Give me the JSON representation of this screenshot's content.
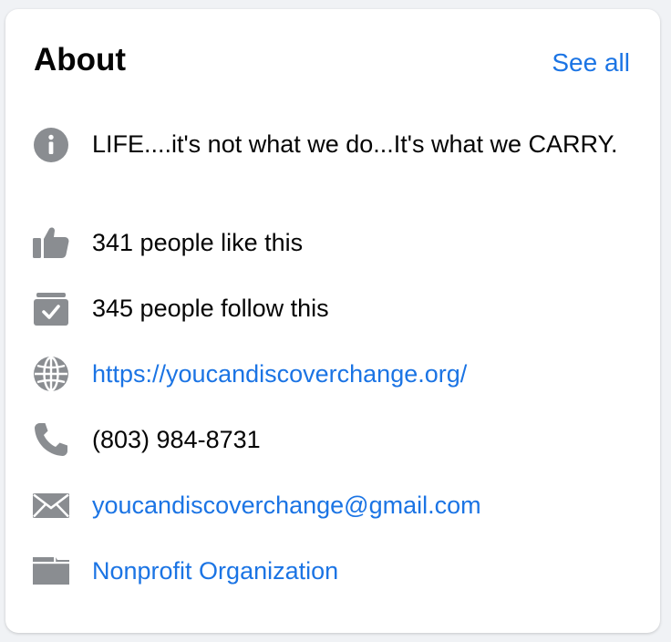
{
  "about": {
    "title": "About",
    "see_all": "See all",
    "items": [
      {
        "icon": "info-icon",
        "text": "LIFE....it's not what we do...It's what we CARRY.",
        "link": false
      },
      {
        "icon": "thumbs-up-icon",
        "text": "341 people like this",
        "link": false
      },
      {
        "icon": "follow-check-icon",
        "text": "345 people follow this",
        "link": false
      },
      {
        "icon": "globe-icon",
        "text": "https://youcandiscoverchange.org/",
        "link": true
      },
      {
        "icon": "phone-icon",
        "text": "(803) 984-8731",
        "link": false
      },
      {
        "icon": "envelope-icon",
        "text": "youcandiscoverchange@gmail.com",
        "link": true
      },
      {
        "icon": "category-icon",
        "text": "Nonprofit Organization",
        "link": true
      }
    ]
  },
  "colors": {
    "link": "#1b74e4",
    "text": "#050505",
    "icon": "#8a8d91",
    "background": "#f0f2f5",
    "card": "#ffffff"
  }
}
